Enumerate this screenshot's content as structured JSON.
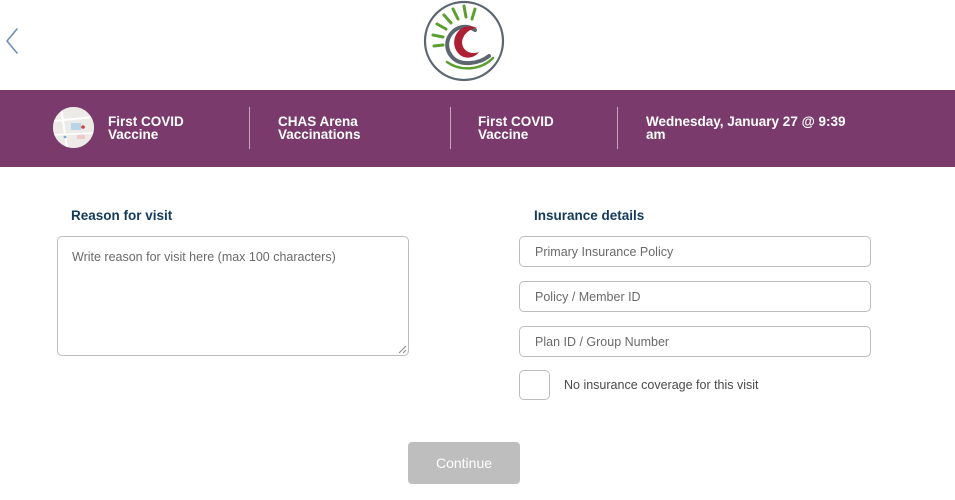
{
  "colors": {
    "banner": "#7a3b6c",
    "section_title": "#123a5a",
    "logo_red": "#b01e32",
    "logo_green": "#5aa02c",
    "logo_gray": "#5c6670",
    "button_disabled": "#bebebe",
    "back_arrow": "#6b8fb5"
  },
  "icons": {
    "back": "chevron-left-icon",
    "logo": "clinic-logo",
    "location_thumb": "map-thumbnail-icon"
  },
  "banner": {
    "item1": {
      "line1": "First COVID",
      "line2": "Vaccine"
    },
    "item2": {
      "line1": "CHAS Arena",
      "line2": "Vaccinations"
    },
    "item3": {
      "line1": "First COVID",
      "line2": "Vaccine"
    },
    "item4": {
      "line1": "Wednesday, January 27 @ 9:39",
      "line2": "am"
    }
  },
  "reason": {
    "title": "Reason for visit",
    "placeholder": "Write reason for visit here (max 100 characters)"
  },
  "insurance": {
    "title": "Insurance details",
    "primary_placeholder": "Primary Insurance Policy",
    "member_placeholder": "Policy / Member ID",
    "plan_placeholder": "Plan ID / Group Number",
    "no_coverage_label": "No insurance coverage for this visit"
  },
  "actions": {
    "continue_label": "Continue"
  }
}
